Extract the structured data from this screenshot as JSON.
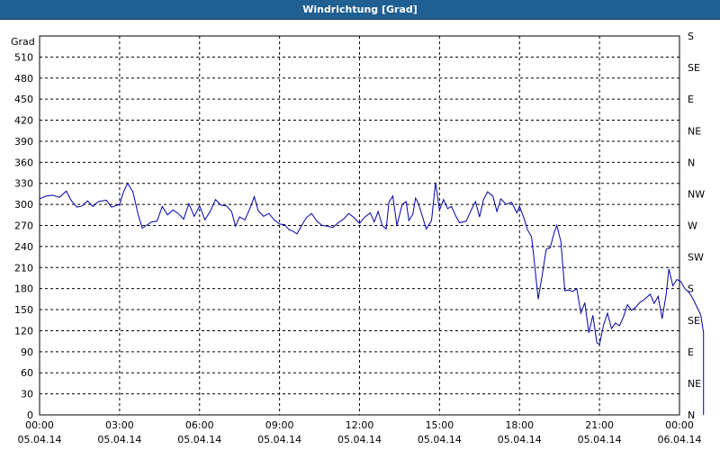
{
  "window_title": "Windrichtung [Grad]",
  "chart_data": {
    "type": "line",
    "title": "Windrichtung [Grad]",
    "ylabel": "Grad",
    "ylim": [
      0,
      540
    ],
    "y_ticks": [
      0,
      30,
      60,
      90,
      120,
      150,
      180,
      210,
      240,
      270,
      300,
      330,
      360,
      390,
      420,
      450,
      480,
      510
    ],
    "y_right_ticks": [
      {
        "value": 0,
        "label": "N"
      },
      {
        "value": 45,
        "label": "NE"
      },
      {
        "value": 90,
        "label": "E"
      },
      {
        "value": 135,
        "label": "SE"
      },
      {
        "value": 180,
        "label": "S"
      },
      {
        "value": 225,
        "label": "SW"
      },
      {
        "value": 270,
        "label": "W"
      },
      {
        "value": 315,
        "label": "NW"
      },
      {
        "value": 360,
        "label": "N"
      },
      {
        "value": 405,
        "label": "NE"
      },
      {
        "value": 450,
        "label": "E"
      },
      {
        "value": 495,
        "label": "SE"
      },
      {
        "value": 540,
        "label": "S"
      }
    ],
    "xlim_hours": [
      0,
      24
    ],
    "x_ticks": [
      {
        "hour": 0,
        "time": "00:00",
        "date": "05.04.14"
      },
      {
        "hour": 3,
        "time": "03:00",
        "date": "05.04.14"
      },
      {
        "hour": 6,
        "time": "06:00",
        "date": "05.04.14"
      },
      {
        "hour": 9,
        "time": "09:00",
        "date": "05.04.14"
      },
      {
        "hour": 12,
        "time": "12:00",
        "date": "05.04.14"
      },
      {
        "hour": 15,
        "time": "15:00",
        "date": "05.04.14"
      },
      {
        "hour": 18,
        "time": "18:00",
        "date": "05.04.14"
      },
      {
        "hour": 21,
        "time": "21:00",
        "date": "05.04.14"
      },
      {
        "hour": 24,
        "time": "00:00",
        "date": "06.04.14"
      }
    ],
    "grid": true,
    "series": [
      {
        "color": "#0000aa",
        "points": [
          [
            0.0,
            308
          ],
          [
            0.25,
            312
          ],
          [
            0.5,
            313
          ],
          [
            0.75,
            310
          ],
          [
            1.0,
            319
          ],
          [
            1.2,
            305
          ],
          [
            1.4,
            296
          ],
          [
            1.6,
            298
          ],
          [
            1.8,
            305
          ],
          [
            2.0,
            297
          ],
          [
            2.2,
            304
          ],
          [
            2.5,
            306
          ],
          [
            2.7,
            296
          ],
          [
            3.0,
            300
          ],
          [
            3.15,
            318
          ],
          [
            3.3,
            330
          ],
          [
            3.5,
            318
          ],
          [
            3.7,
            285
          ],
          [
            3.85,
            266
          ],
          [
            4.0,
            270
          ],
          [
            4.2,
            275
          ],
          [
            4.4,
            276
          ],
          [
            4.6,
            297
          ],
          [
            4.8,
            285
          ],
          [
            5.0,
            292
          ],
          [
            5.2,
            287
          ],
          [
            5.4,
            279
          ],
          [
            5.6,
            301
          ],
          [
            5.8,
            283
          ],
          [
            6.0,
            298
          ],
          [
            6.2,
            278
          ],
          [
            6.4,
            290
          ],
          [
            6.6,
            307
          ],
          [
            6.8,
            299
          ],
          [
            7.0,
            298
          ],
          [
            7.2,
            290
          ],
          [
            7.35,
            269
          ],
          [
            7.5,
            282
          ],
          [
            7.7,
            278
          ],
          [
            7.9,
            295
          ],
          [
            8.05,
            311
          ],
          [
            8.2,
            291
          ],
          [
            8.4,
            283
          ],
          [
            8.6,
            287
          ],
          [
            8.8,
            278
          ],
          [
            9.0,
            272
          ],
          [
            9.2,
            271
          ],
          [
            9.35,
            264
          ],
          [
            9.5,
            262
          ],
          [
            9.65,
            258
          ],
          [
            9.8,
            268
          ],
          [
            10.0,
            281
          ],
          [
            10.2,
            287
          ],
          [
            10.4,
            276
          ],
          [
            10.6,
            270
          ],
          [
            10.8,
            269
          ],
          [
            11.0,
            267
          ],
          [
            11.2,
            274
          ],
          [
            11.4,
            279
          ],
          [
            11.6,
            287
          ],
          [
            11.8,
            281
          ],
          [
            12.0,
            273
          ],
          [
            12.2,
            282
          ],
          [
            12.4,
            288
          ],
          [
            12.55,
            275
          ],
          [
            12.7,
            290
          ],
          [
            12.85,
            270
          ],
          [
            13.0,
            265
          ],
          [
            13.1,
            303
          ],
          [
            13.25,
            312
          ],
          [
            13.4,
            270
          ],
          [
            13.6,
            300
          ],
          [
            13.75,
            304
          ],
          [
            13.85,
            277
          ],
          [
            14.0,
            286
          ],
          [
            14.1,
            309
          ],
          [
            14.2,
            302
          ],
          [
            14.35,
            284
          ],
          [
            14.5,
            265
          ],
          [
            14.7,
            277
          ],
          [
            14.85,
            331
          ],
          [
            15.0,
            292
          ],
          [
            15.15,
            307
          ],
          [
            15.3,
            294
          ],
          [
            15.45,
            297
          ],
          [
            15.6,
            284
          ],
          [
            15.75,
            274
          ],
          [
            16.0,
            276
          ],
          [
            16.2,
            293
          ],
          [
            16.35,
            304
          ],
          [
            16.5,
            282
          ],
          [
            16.65,
            307
          ],
          [
            16.8,
            318
          ],
          [
            17.0,
            312
          ],
          [
            17.15,
            290
          ],
          [
            17.3,
            308
          ],
          [
            17.5,
            300
          ],
          [
            17.7,
            303
          ],
          [
            17.9,
            288
          ],
          [
            18.0,
            297
          ],
          [
            18.15,
            282
          ],
          [
            18.3,
            264
          ],
          [
            18.45,
            254
          ],
          [
            18.55,
            221
          ],
          [
            18.7,
            165
          ],
          [
            18.85,
            199
          ],
          [
            19.0,
            236
          ],
          [
            19.15,
            238
          ],
          [
            19.3,
            260
          ],
          [
            19.4,
            270
          ],
          [
            19.55,
            247
          ],
          [
            19.7,
            177
          ],
          [
            19.85,
            178
          ],
          [
            20.0,
            176
          ],
          [
            20.15,
            180
          ],
          [
            20.3,
            145
          ],
          [
            20.45,
            160
          ],
          [
            20.6,
            117
          ],
          [
            20.75,
            142
          ],
          [
            20.9,
            103
          ],
          [
            21.0,
            100
          ],
          [
            21.15,
            128
          ],
          [
            21.3,
            145
          ],
          [
            21.45,
            123
          ],
          [
            21.6,
            131
          ],
          [
            21.75,
            127
          ],
          [
            21.9,
            140
          ],
          [
            22.05,
            157
          ],
          [
            22.2,
            149
          ],
          [
            22.35,
            153
          ],
          [
            22.5,
            160
          ],
          [
            22.7,
            165
          ],
          [
            22.9,
            172
          ],
          [
            23.05,
            159
          ],
          [
            23.2,
            169
          ],
          [
            23.35,
            137
          ],
          [
            23.5,
            172
          ],
          [
            23.6,
            208
          ],
          [
            23.75,
            184
          ],
          [
            23.9,
            193
          ],
          [
            24.05,
            190
          ],
          [
            24.2,
            180
          ],
          [
            24.35,
            175
          ],
          [
            24.5,
            166
          ],
          [
            24.65,
            154
          ],
          [
            24.8,
            142
          ],
          [
            24.95,
            117
          ],
          [
            25.05,
            50
          ],
          [
            25.15,
            0
          ]
        ]
      }
    ]
  }
}
